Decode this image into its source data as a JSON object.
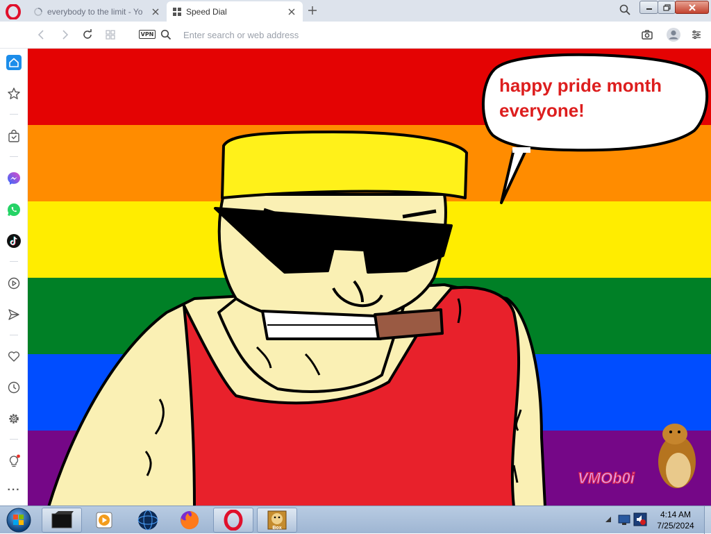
{
  "browser": {
    "tabs": [
      {
        "title": "everybody to the limit - Yo",
        "state": "loading"
      },
      {
        "title": "Speed Dial",
        "state": "active"
      }
    ],
    "address": {
      "placeholder": "Enter search or web address",
      "value": ""
    },
    "vpn_label": "VPN"
  },
  "sidebar": {
    "items": [
      "home-icon",
      "star-icon",
      "shopping-bag-icon",
      "messenger-icon",
      "whatsapp-icon",
      "tiktok-icon",
      "player-icon",
      "send-icon",
      "heart-icon",
      "history-icon",
      "settings-icon",
      "tips-icon",
      "more-icon"
    ],
    "more_label": "···"
  },
  "wallpaper": {
    "stripe_colors": [
      "#e40303",
      "#ff8c00",
      "#ffed00",
      "#008026",
      "#004dff",
      "#750787"
    ],
    "speech_text_line1": "happy pride month",
    "speech_text_line2": "everyone!",
    "speech_color": "#dd1e1e",
    "watermark": "VMOb0i"
  },
  "taskbar": {
    "items": [
      "terminal-icon",
      "media-player-icon",
      "globe-icon",
      "firefox-icon",
      "opera-icon",
      "hamster-box-icon"
    ],
    "hamster_box_label": "Box",
    "clock_time": "4:14 AM",
    "clock_date": "7/25/2024"
  }
}
